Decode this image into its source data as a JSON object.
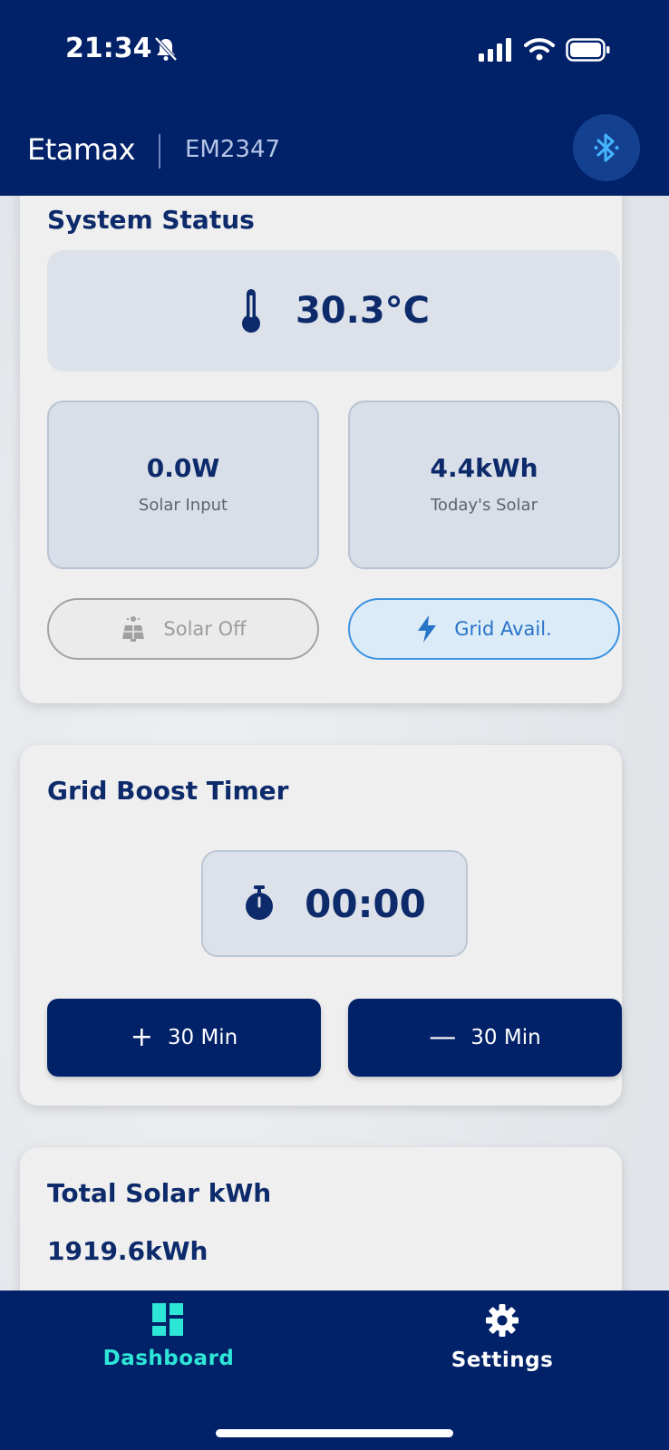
{
  "status_bar": {
    "time": "21:34"
  },
  "header": {
    "brand": "Etamax",
    "device_id": "EM2347"
  },
  "system_status": {
    "title": "System Status",
    "temperature": "30.3°C",
    "solar_input": {
      "value": "0.0W",
      "label": "Solar Input"
    },
    "todays_solar": {
      "value": "4.4kWh",
      "label": "Today's Solar"
    },
    "solar_state": "Solar Off",
    "grid_state": "Grid Avail."
  },
  "grid_boost": {
    "title": "Grid Boost Timer",
    "timer": "00:00",
    "add_label": "30 Min",
    "subtract_label": "30 Min"
  },
  "total_solar": {
    "title": "Total Solar kWh",
    "value": "1919.6kWh"
  },
  "tabs": [
    {
      "label": "Dashboard",
      "icon": "dashboard-icon",
      "active": true
    },
    {
      "label": "Settings",
      "icon": "gear-icon",
      "active": false
    }
  ],
  "colors": {
    "primary": "#012169",
    "active_tab": "#2ee6d6",
    "grid_accent": "#3d93e0",
    "bluetooth": "#45b4ff"
  }
}
